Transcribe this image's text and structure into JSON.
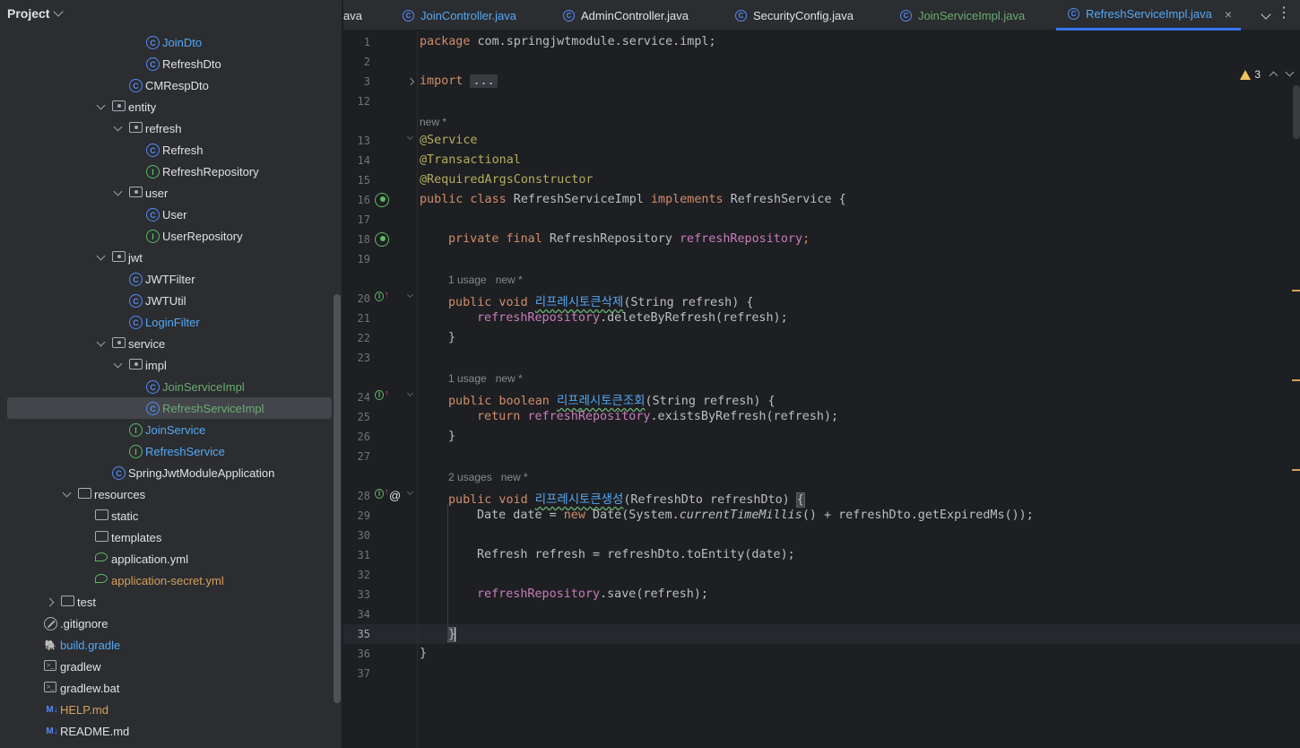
{
  "project_panel": {
    "title": "Project",
    "tree": [
      {
        "label": "JoinDto",
        "icon": "class",
        "color": "blue",
        "indent": 163
      },
      {
        "label": "RefreshDto",
        "icon": "class",
        "color": "default",
        "indent": 163
      },
      {
        "label": "CMRespDto",
        "icon": "class",
        "color": "default",
        "indent": 144
      },
      {
        "label": "entity",
        "icon": "package",
        "color": "default",
        "indent": 125,
        "arrow": "down"
      },
      {
        "label": "refresh",
        "icon": "package",
        "color": "default",
        "indent": 144,
        "arrow": "down"
      },
      {
        "label": "Refresh",
        "icon": "class",
        "color": "default",
        "indent": 163
      },
      {
        "label": "RefreshRepository",
        "icon": "interface",
        "color": "default",
        "indent": 163
      },
      {
        "label": "user",
        "icon": "package",
        "color": "default",
        "indent": 144,
        "arrow": "down"
      },
      {
        "label": "User",
        "icon": "class",
        "color": "default",
        "indent": 163
      },
      {
        "label": "UserRepository",
        "icon": "interface",
        "color": "default",
        "indent": 163
      },
      {
        "label": "jwt",
        "icon": "package",
        "color": "default",
        "indent": 125,
        "arrow": "down"
      },
      {
        "label": "JWTFilter",
        "icon": "class",
        "color": "default",
        "indent": 144
      },
      {
        "label": "JWTUtil",
        "icon": "class",
        "color": "default",
        "indent": 144
      },
      {
        "label": "LoginFilter",
        "icon": "class",
        "color": "blue",
        "indent": 144
      },
      {
        "label": "service",
        "icon": "package",
        "color": "default",
        "indent": 125,
        "arrow": "down"
      },
      {
        "label": "impl",
        "icon": "package",
        "color": "default",
        "indent": 144,
        "arrow": "down"
      },
      {
        "label": "JoinServiceImpl",
        "icon": "class",
        "color": "green",
        "indent": 163
      },
      {
        "label": "RefreshServiceImpl",
        "icon": "class",
        "color": "green",
        "indent": 163,
        "selected": true
      },
      {
        "label": "JoinService",
        "icon": "interface",
        "color": "blue",
        "indent": 144
      },
      {
        "label": "RefreshService",
        "icon": "interface",
        "color": "blue",
        "indent": 144
      },
      {
        "label": "SpringJwtModuleApplication",
        "icon": "app",
        "color": "default",
        "indent": 125
      },
      {
        "label": "resources",
        "icon": "folder",
        "color": "default",
        "indent": 87,
        "arrow": "down"
      },
      {
        "label": "static",
        "icon": "folder",
        "color": "default",
        "indent": 106
      },
      {
        "label": "templates",
        "icon": "folder",
        "color": "default",
        "indent": 106
      },
      {
        "label": "application.yml",
        "icon": "yml",
        "color": "default",
        "indent": 106
      },
      {
        "label": "application-secret.yml",
        "icon": "yml",
        "color": "orange",
        "indent": 106
      },
      {
        "label": "test",
        "icon": "folder",
        "color": "default",
        "indent": 68,
        "arrow": "right"
      },
      {
        "label": ".gitignore",
        "icon": "ignore",
        "color": "default",
        "indent": 49
      },
      {
        "label": "build.gradle",
        "icon": "gradle",
        "color": "blue",
        "indent": 49
      },
      {
        "label": "gradlew",
        "icon": "terminal",
        "color": "default",
        "indent": 49
      },
      {
        "label": "gradlew.bat",
        "icon": "terminal",
        "color": "default",
        "indent": 49
      },
      {
        "label": "HELP.md",
        "icon": "markdown",
        "color": "orange",
        "indent": 49
      },
      {
        "label": "README.md",
        "icon": "markdown",
        "color": "default",
        "indent": 49
      }
    ]
  },
  "tabs": [
    {
      "label": "ava",
      "color": "default",
      "icon": false
    },
    {
      "label": "JoinController.java",
      "color": "blue",
      "icon": true
    },
    {
      "label": "AdminController.java",
      "color": "default",
      "icon": true
    },
    {
      "label": "SecurityConfig.java",
      "color": "default",
      "icon": true
    },
    {
      "label": "JoinServiceImpl.java",
      "color": "green",
      "icon": true
    },
    {
      "label": "RefreshServiceImpl.java",
      "color": "blue",
      "icon": true,
      "active": true,
      "close": "×"
    }
  ],
  "editor": {
    "warnings_count": "3",
    "hints": {
      "new": "new *",
      "usage1a": "1 usage   new *",
      "usage1b": "1 usage   new *",
      "usage2": "2 usages   new *"
    },
    "line_numbers": [
      "1",
      "2",
      "3",
      "12",
      "13",
      "14",
      "15",
      "16",
      "17",
      "18",
      "19",
      "20",
      "21",
      "22",
      "23",
      "24",
      "25",
      "26",
      "27",
      "28",
      "29",
      "30",
      "31",
      "32",
      "33",
      "34",
      "35",
      "36",
      "37"
    ],
    "code": {
      "package_kw": "package",
      "package_name": " com.springjwtmodule.service.impl;",
      "import_kw": "import",
      "import_fold": "...",
      "ann_service": "@Service",
      "ann_transactional": "@Transactional",
      "ann_rac": "@RequiredArgsConstructor",
      "class_kw": "public class",
      "class_name": " RefreshServiceImpl ",
      "implements_kw": "implements",
      "class_tail": " RefreshService {",
      "field_kw": "private final",
      "field_type": " RefreshRepository ",
      "field_name": "refreshRepository",
      "field_end": ";",
      "m1_kw": "public void",
      "m1_name": "리프레시토큰삭제",
      "m1_params": "(String refresh) {",
      "m1_body_field": "refreshRepository",
      "m1_body_rest": ".deleteByRefresh(refresh);",
      "close_brace": "}",
      "m2_kw": "public boolean",
      "m2_name": "리프레시토큰조회",
      "m2_params": "(String refresh) {",
      "m2_return_kw": "return",
      "m2_body_field": "refreshRepository",
      "m2_body_rest": ".existsByRefresh(refresh);",
      "m3_kw": "public void",
      "m3_name": "리프레시토큰생성",
      "m3_params": "(RefreshDto refreshDto) ",
      "m3_open": "{",
      "l29_a": "Date date = ",
      "l29_new": "new",
      "l29_b": " Date(System.",
      "l29_it": "currentTimeMillis",
      "l29_c": "() + refreshDto.getExpiredMs());",
      "l31": "Refresh refresh = refreshDto.toEntity(date);",
      "l33_field": "refreshRepository",
      "l33_rest": ".save(refresh);",
      "l35": "}",
      "l36": "}"
    }
  }
}
